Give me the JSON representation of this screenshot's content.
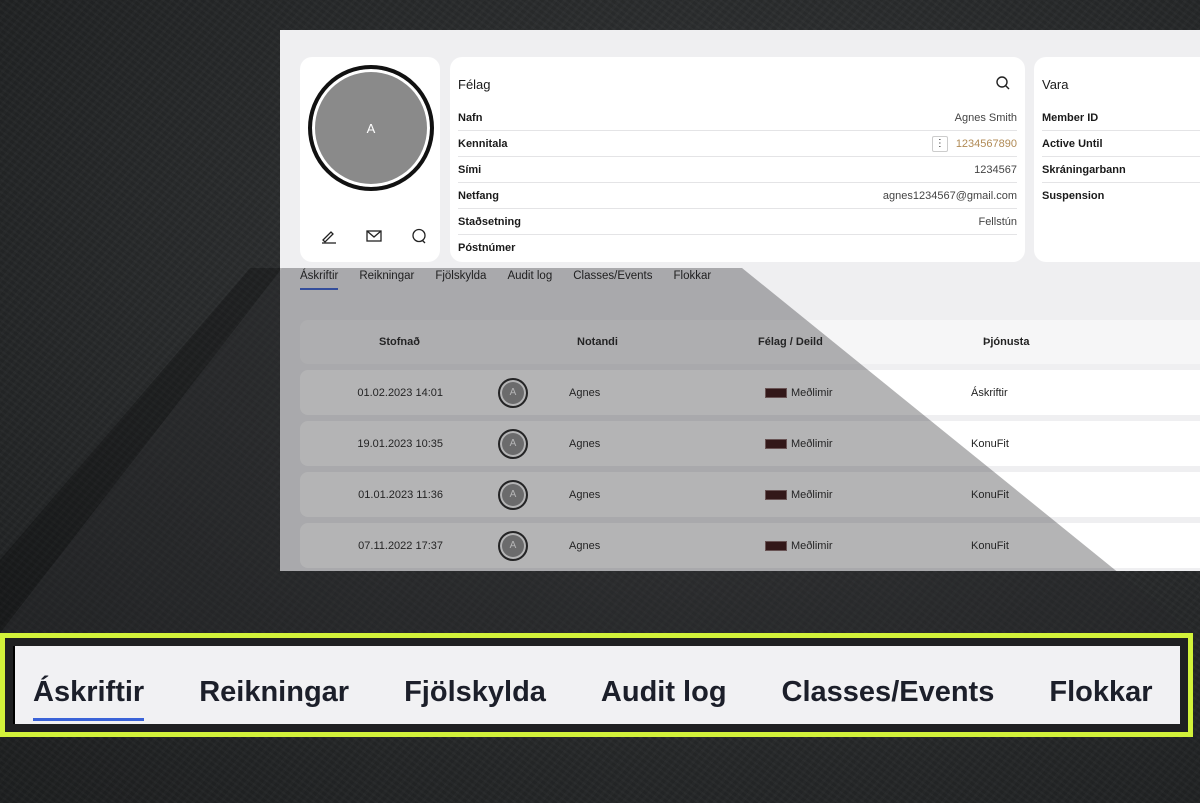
{
  "profile": {
    "avatar_initial": "A",
    "actions": [
      "edit-icon",
      "mail-icon",
      "chat-icon"
    ]
  },
  "felag": {
    "title": "Félag",
    "rows": [
      {
        "label": "Nafn",
        "value": "Agnes Smith"
      },
      {
        "label": "Kennitala",
        "value": "1234567890"
      },
      {
        "label": "Sími",
        "value": "1234567"
      },
      {
        "label": "Netfang",
        "value": "agnes1234567@gmail.com"
      },
      {
        "label": "Staðsetning",
        "value": "Fellstún"
      },
      {
        "label": "Póstnúmer",
        "value": ""
      }
    ],
    "kennitala_color": "#b08a55"
  },
  "vara": {
    "title": "Vara",
    "rows": [
      {
        "label": "Member ID"
      },
      {
        "label": "Active Until"
      },
      {
        "label": "Skráningarbann"
      },
      {
        "label": "Suspension"
      }
    ]
  },
  "tabs": [
    "Áskriftir",
    "Reikningar",
    "Fjölskylda",
    "Audit log",
    "Classes/Events",
    "Flokkar"
  ],
  "active_tab": "Áskriftir",
  "table": {
    "headers": [
      "Stofnað",
      "Notandi",
      "Félag / Deild",
      "Þjónusta"
    ],
    "rows": [
      {
        "date": "01.02.2023 14:01",
        "avatar": "A",
        "user": "Agnes",
        "felag": "Meðlimir",
        "service": "Áskriftir"
      },
      {
        "date": "19.01.2023 10:35",
        "avatar": "A",
        "user": "Agnes",
        "felag": "Meðlimir",
        "service": "KonuFit"
      },
      {
        "date": "01.01.2023 11:36",
        "avatar": "A",
        "user": "Agnes",
        "felag": "Meðlimir",
        "service": "KonuFit"
      },
      {
        "date": "07.11.2022 17:37",
        "avatar": "A",
        "user": "Agnes",
        "felag": "Meðlimir",
        "service": "KonuFit"
      }
    ]
  },
  "colors": {
    "accent": "#3b63d8",
    "highlight_border": "#d2f23a"
  }
}
